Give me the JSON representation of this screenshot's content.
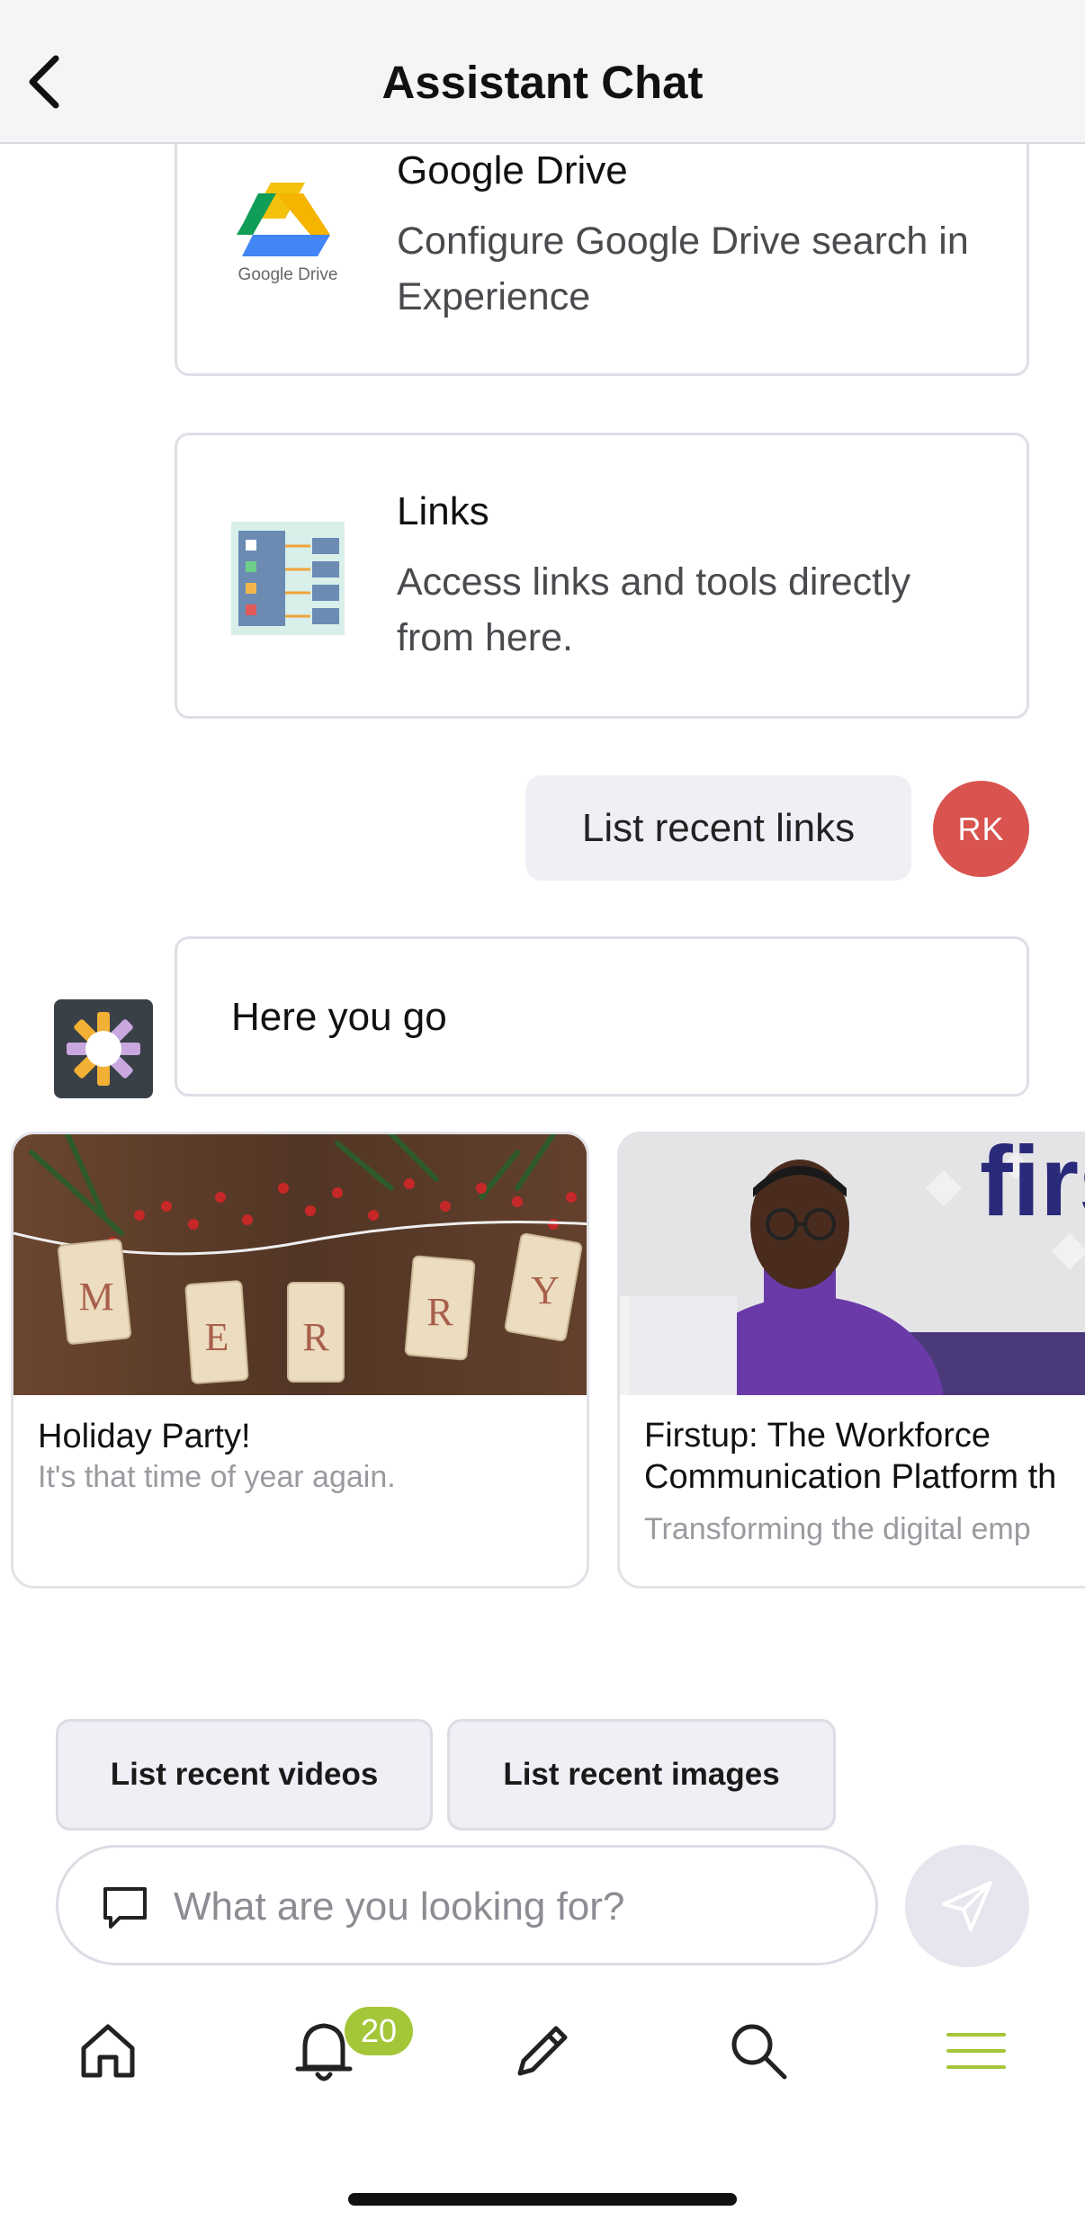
{
  "header": {
    "title": "Assistant Chat"
  },
  "integrations": [
    {
      "title": "Google Drive",
      "description": "Configure Google Drive search in Experience",
      "logo_caption": "Google Drive"
    },
    {
      "title": "Links",
      "description": "Access links and tools directly from here."
    }
  ],
  "user_message": {
    "text": "List recent links",
    "avatar_initials": "RK"
  },
  "bot_message": {
    "text": "Here you go"
  },
  "link_cards": [
    {
      "title": "Holiday Party!",
      "subtitle": "It's that time of year again.",
      "image_letters": [
        "M",
        "E",
        "R",
        "R",
        "Y"
      ]
    },
    {
      "title_line1": "Firstup: The Workforce",
      "title_line2": "Communication Platform th",
      "subtitle": "Transforming the digital emp",
      "image_text": "firs"
    }
  ],
  "suggestions": [
    "List recent videos",
    "List recent images"
  ],
  "input": {
    "placeholder": "What are you looking for?",
    "value": ""
  },
  "nav": {
    "items": [
      "home-icon",
      "bell-icon",
      "pencil-icon",
      "search-icon",
      "menu-icon"
    ],
    "notification_count": "20"
  },
  "colors": {
    "accent": "#a4c639",
    "avatar": "#d9534f",
    "chip_bg": "#efeff5"
  }
}
